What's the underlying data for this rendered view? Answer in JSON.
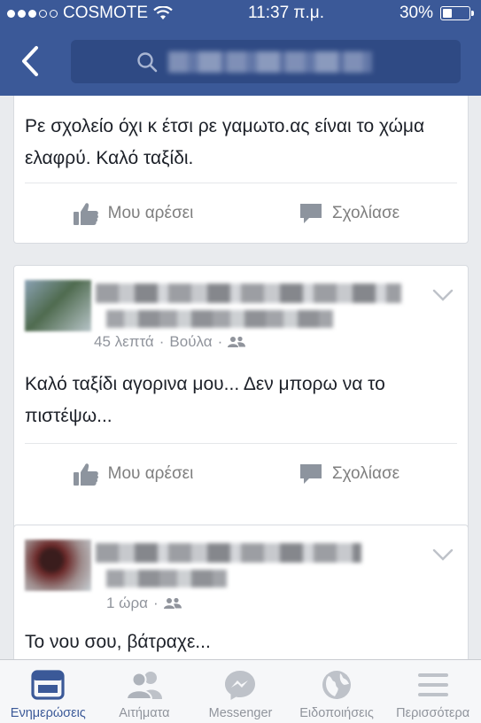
{
  "status_bar": {
    "carrier": "COSMOTE",
    "time": "11:37 π.μ.",
    "battery_percent": "30%",
    "battery_level": 0.3
  },
  "search": {
    "placeholder": ""
  },
  "posts": [
    {
      "text": "Ρε σχολείο όχι κ έτσι ρε γαμωτο.ας είναι το χώμα ελαφρύ. Καλό ταξίδι.",
      "like_label": "Μου αρέσει",
      "comment_label": "Σχολίασε"
    },
    {
      "time": "45 λεπτά",
      "separator": "·",
      "location": "Βούλα",
      "text": "Καλό ταξίδι αγορινα μου... Δεν μπορω να το πιστέψω...",
      "like_label": "Μου αρέσει",
      "comment_label": "Σχολίασε"
    },
    {
      "time": "1 ώρα",
      "separator": "·",
      "text": "Το νου σου, βάτραχε..."
    }
  ],
  "tabs": [
    {
      "label": "Ενημερώσεις",
      "icon": "news-feed-icon",
      "active": true
    },
    {
      "label": "Αιτήματα",
      "icon": "friend-requests-icon",
      "active": false
    },
    {
      "label": "Messenger",
      "icon": "messenger-icon",
      "active": false
    },
    {
      "label": "Ειδοποιήσεις",
      "icon": "globe-icon",
      "active": false
    },
    {
      "label": "Περισσότερα",
      "icon": "menu-icon",
      "active": false
    }
  ],
  "colors": {
    "brand": "#3b5998",
    "background": "#e9ebee",
    "muted": "#90949c"
  }
}
